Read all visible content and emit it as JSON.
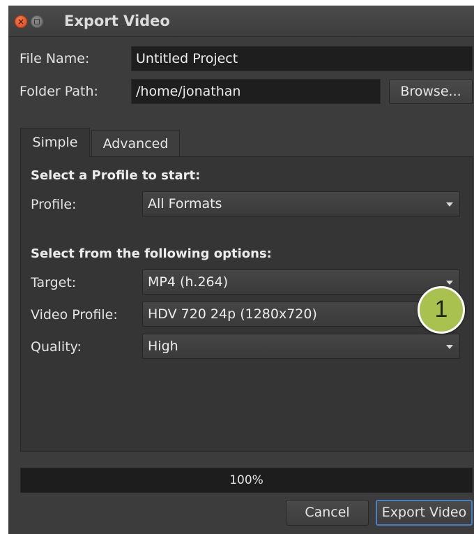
{
  "window": {
    "title": "Export Video"
  },
  "file": {
    "name_label": "File Name:",
    "name_value": "Untitled Project",
    "path_label": "Folder Path:",
    "path_value": "/home/jonathan",
    "browse_label": "Browse..."
  },
  "tabs": [
    {
      "label": "Simple",
      "active": true
    },
    {
      "label": "Advanced",
      "active": false
    }
  ],
  "simple": {
    "profile_heading": "Select a Profile to start:",
    "profile_label": "Profile:",
    "profile_value": "All Formats",
    "options_heading": "Select from the following options:",
    "target_label": "Target:",
    "target_value": "MP4 (h.264)",
    "video_profile_label": "Video Profile:",
    "video_profile_value": "HDV 720 24p (1280x720)",
    "quality_label": "Quality:",
    "quality_value": "High"
  },
  "progress": {
    "value": 100,
    "text": "100%"
  },
  "buttons": {
    "cancel": "Cancel",
    "export": "Export Video"
  },
  "callout": {
    "number": "1"
  },
  "colors": {
    "window_bg": "#3c3c3c",
    "field_bg": "#1e1e1e",
    "callout": "#a9c14e",
    "close_button": "#e2571f"
  },
  "icons": {
    "close": "close-icon",
    "minimize": "minimize-icon",
    "dropdown": "chevron-down-icon"
  }
}
